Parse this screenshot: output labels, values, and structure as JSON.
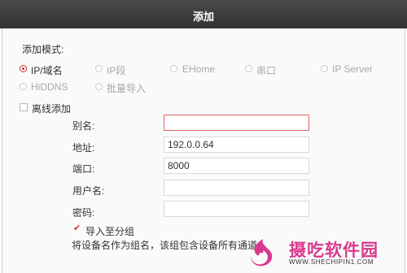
{
  "window": {
    "title": "添加"
  },
  "mode": {
    "label": "添加模式:",
    "options": [
      {
        "label": "IP/域名",
        "selected": true
      },
      {
        "label": "IP段",
        "selected": false
      },
      {
        "label": "EHome",
        "selected": false
      },
      {
        "label": "串口",
        "selected": false
      },
      {
        "label": "IP Server",
        "selected": false
      },
      {
        "label": "HiDDNS",
        "selected": false
      },
      {
        "label": "批量导入",
        "selected": false
      }
    ]
  },
  "offline": {
    "label": "离线添加",
    "checked": false
  },
  "form": {
    "alias": {
      "label": "别名:",
      "value": ""
    },
    "address": {
      "label": "地址:",
      "value": "192.0.0.64"
    },
    "port": {
      "label": "端口:",
      "value": "8000"
    },
    "username": {
      "label": "用户名:",
      "value": ""
    },
    "password": {
      "label": "密码:",
      "value": ""
    }
  },
  "group": {
    "label": "导入至分组",
    "checked": true,
    "note": "将设备名作为组名，该组包含设备所有通道。"
  },
  "watermark": {
    "name": "摄吃软件园",
    "url": "WWW.SHECHIPIN1.COM"
  },
  "colors": {
    "accent": "#d2302f",
    "titlebar": "#3c3c3c",
    "watermark": "#d73a8e"
  }
}
